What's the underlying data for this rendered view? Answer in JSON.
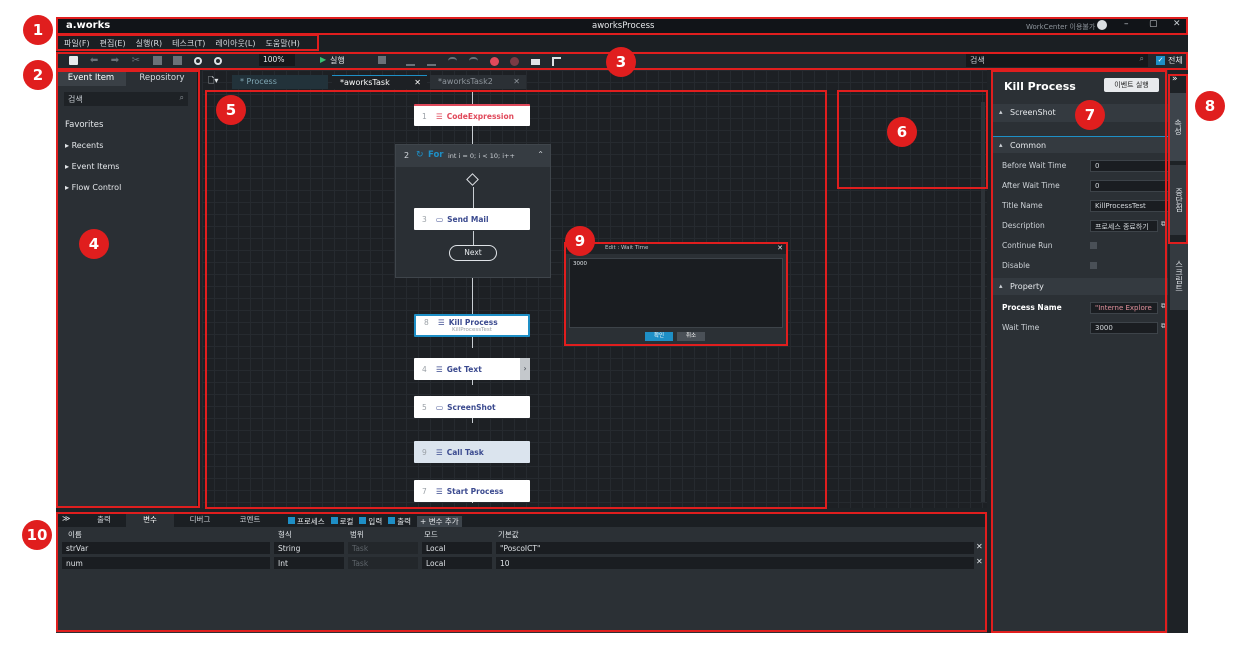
{
  "window": {
    "logo": "a.works",
    "title": "aworksProcess",
    "workcenter": "WorkCenter 이용불가",
    "controls": [
      "–",
      "▢",
      "✕"
    ]
  },
  "menu": [
    "파일(F)",
    "편집(E)",
    "실행(R)",
    "테스크(T)",
    "레이아웃(L)",
    "도움말(H)"
  ],
  "toolbar": {
    "zoom": "100%",
    "run_label": "실행",
    "search_placeholder": "검색",
    "all_label": "전체"
  },
  "sidebar": {
    "tabs": [
      "Event Item",
      "Repository"
    ],
    "search_placeholder": "검색",
    "favorites": "Favorites",
    "items": [
      "Recents",
      "Event Items",
      "Flow Control"
    ]
  },
  "doc_tabs": [
    {
      "label": "* Process",
      "closable": false
    },
    {
      "label": "*aworksTask",
      "closable": true
    },
    {
      "label": "*aworksTask2",
      "closable": true
    }
  ],
  "flow": {
    "nodes": [
      {
        "num": "1",
        "label": "CodeExpression"
      },
      {
        "num": "3",
        "label": "Send Mail"
      },
      {
        "num": "8",
        "label": "Kill Process",
        "sub": "KillProcessTest"
      },
      {
        "num": "4",
        "label": "Get Text"
      },
      {
        "num": "5",
        "label": "ScreenShot"
      },
      {
        "num": "9",
        "label": "Call Task"
      },
      {
        "num": "7",
        "label": "Start Process"
      }
    ],
    "for_loop": {
      "num": "2",
      "label": "For",
      "expr": "int i = 0; i < 10; i++"
    },
    "next": "Next"
  },
  "popup": {
    "title": "Edit : Wait Time",
    "value": "3000",
    "ok": "확인",
    "cancel": "취소"
  },
  "props": {
    "title": "Kill Process",
    "run_event": "이벤트 실행",
    "sections": {
      "screenshot": "ScreenShot",
      "common": "Common",
      "property": "Property"
    },
    "common": [
      {
        "label": "Before Wait Time",
        "value": "0"
      },
      {
        "label": "After Wait Time",
        "value": "0"
      },
      {
        "label": "Title Name",
        "value": "KillProcessTest"
      },
      {
        "label": "Description",
        "value": "프로세스 종료하기"
      },
      {
        "label": "Continue Run",
        "value": ""
      },
      {
        "label": "Disable",
        "value": ""
      }
    ],
    "property": [
      {
        "label": "Process Name",
        "value": "\"Interne Explore"
      },
      {
        "label": "Wait Time",
        "value": "3000"
      }
    ]
  },
  "side_tabs": [
    "속성",
    "중단점",
    "스크립트"
  ],
  "bottom": {
    "tabs": [
      "출력",
      "변수",
      "디버그",
      "코멘트"
    ],
    "filters": [
      "프로세스",
      "로컬",
      "입력",
      "출력"
    ],
    "add_var": "+ 변수 추가",
    "headers": [
      "이름",
      "형식",
      "범위",
      "모드",
      "기본값"
    ],
    "rows": [
      {
        "name": "strVar",
        "type": "String",
        "scope": "Task",
        "mode": "Local",
        "value": "\"PoscoICT\""
      },
      {
        "name": "num",
        "type": "Int",
        "scope": "Task",
        "mode": "Local",
        "value": "10"
      }
    ]
  },
  "markers": [
    "1",
    "2",
    "3",
    "4",
    "5",
    "6",
    "7",
    "8",
    "9",
    "10"
  ],
  "colors": {
    "annotation": "#e01e1e",
    "node_text": "#3b4a8f",
    "code_node": "#e0495b",
    "accent_blue": "#1e8fc6"
  }
}
